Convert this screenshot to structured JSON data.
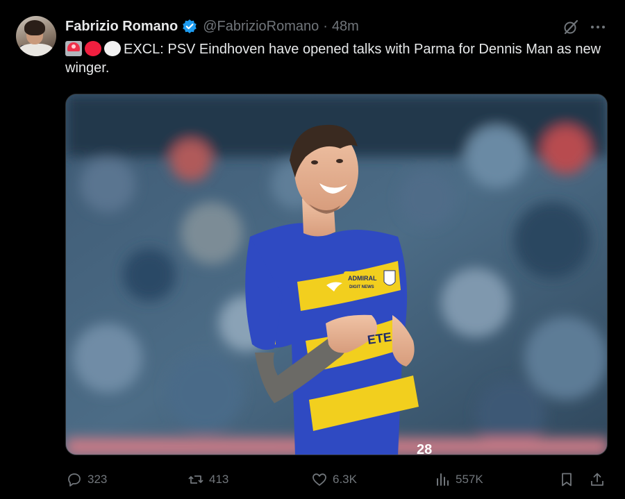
{
  "tweet": {
    "author_name": "Fabrizio Romano",
    "handle": "@FabrizioRomano",
    "separator": "·",
    "time": "48m",
    "text": "EXCL: PSV Eindhoven have opened talks with Parma for Dennis Man as new winger.",
    "emojis": [
      "siren-emoji",
      "red-circle-emoji",
      "white-circle-emoji"
    ]
  },
  "media": {
    "sponsor_line1": "ADMIRAL",
    "sponsor_line2": "DIGIT NEWS",
    "chest_text": "ETE",
    "shirt_colors": {
      "blue": "#2f4ac2",
      "yellow": "#f2cf1e"
    },
    "number_fragment": "28"
  },
  "actions": {
    "replies": "323",
    "reposts": "413",
    "likes": "6.3K",
    "views": "557K"
  },
  "colors": {
    "background": "#000000",
    "text": "#e7e9ea",
    "secondary": "#71767b",
    "verified": "#1d9bf0"
  }
}
